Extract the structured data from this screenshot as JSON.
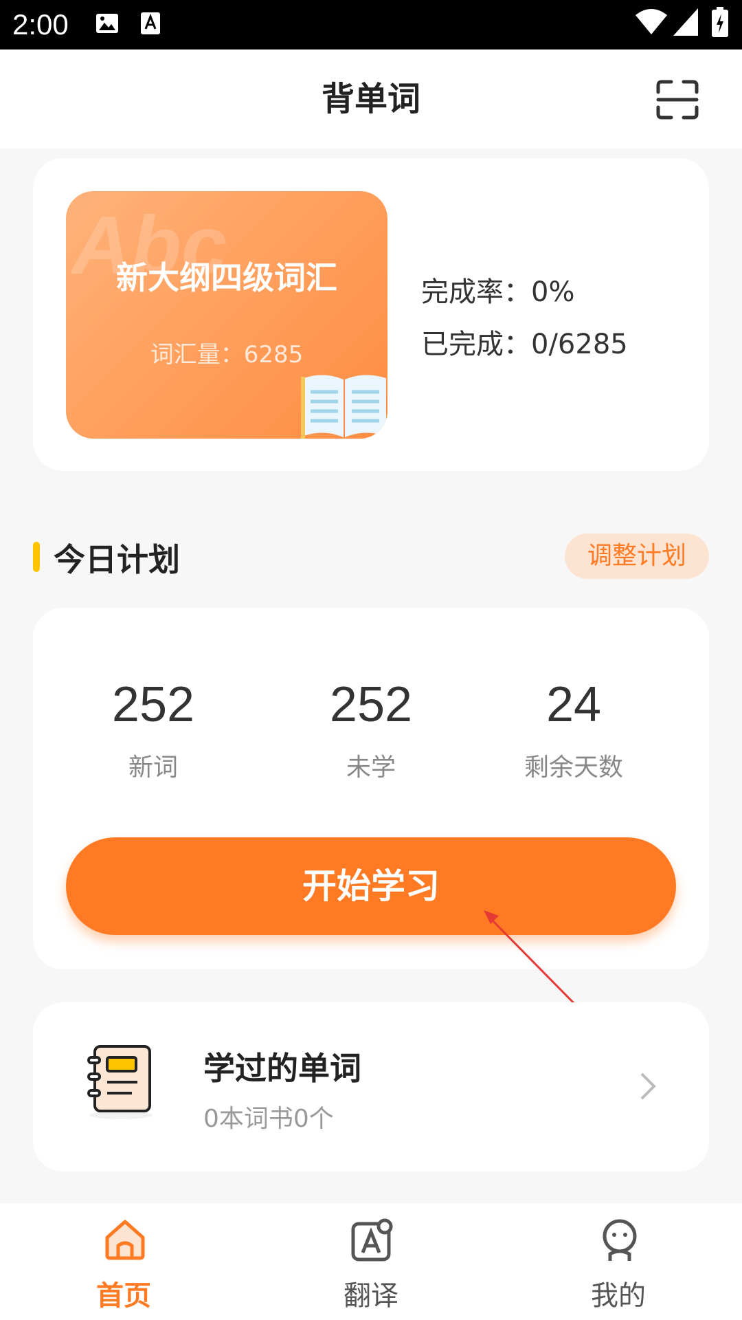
{
  "status_bar": {
    "time": "2:00"
  },
  "header": {
    "title": "背单词"
  },
  "book": {
    "name": "新大纲四级词汇",
    "vocab_count": "词汇量：6285",
    "cover_letters": "Abc",
    "completion_rate": "完成率：0%",
    "completed": "已完成：0/6285"
  },
  "plan": {
    "section_title": "今日计划",
    "adjust_label": "调整计划",
    "stats": [
      {
        "value": "252",
        "label": "新词"
      },
      {
        "value": "252",
        "label": "未学"
      },
      {
        "value": "24",
        "label": "剩余天数"
      }
    ],
    "start_label": "开始学习"
  },
  "learned": {
    "title": "学过的单词",
    "subtitle": "0本词书0个"
  },
  "nav": {
    "items": [
      {
        "label": "首页",
        "icon": "home-icon",
        "active": true
      },
      {
        "label": "翻译",
        "icon": "translate-icon",
        "active": false
      },
      {
        "label": "我的",
        "icon": "profile-icon",
        "active": false
      }
    ]
  },
  "colors": {
    "accent": "#ff7a22",
    "accent_light": "#fde4d2",
    "section_marker": "#ffc400",
    "background": "#f7f7f7"
  }
}
